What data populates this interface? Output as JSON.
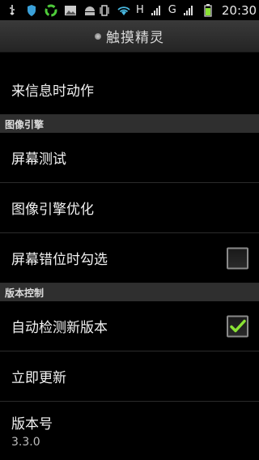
{
  "status_bar": {
    "icons_left": [
      "usb-icon",
      "shield-icon",
      "sync-icon",
      "image-icon",
      "android-icon"
    ],
    "icons_right": [
      "vibrate-icon",
      "wifi-icon",
      "signal-icon",
      "battery-icon"
    ],
    "network_h": "H",
    "network_g": "G",
    "time": "20:30"
  },
  "header": {
    "title": "触摸精灵"
  },
  "settings": {
    "incoming_call_action": "来信息时动作",
    "section_image_engine": "图像引擎",
    "screen_test": "屏幕测试",
    "image_engine_optimize": "图像引擎优化",
    "screen_misalign_check": "屏幕错位时勾选",
    "screen_misalign_checked": false,
    "section_version_control": "版本控制",
    "auto_check_new_version": "自动检测新版本",
    "auto_check_checked": true,
    "update_now": "立即更新",
    "version_label": "版本号",
    "version_value": "3.3.0"
  },
  "colors": {
    "accent_check": "#8ae234",
    "section_bg": "#2f2f2f"
  }
}
